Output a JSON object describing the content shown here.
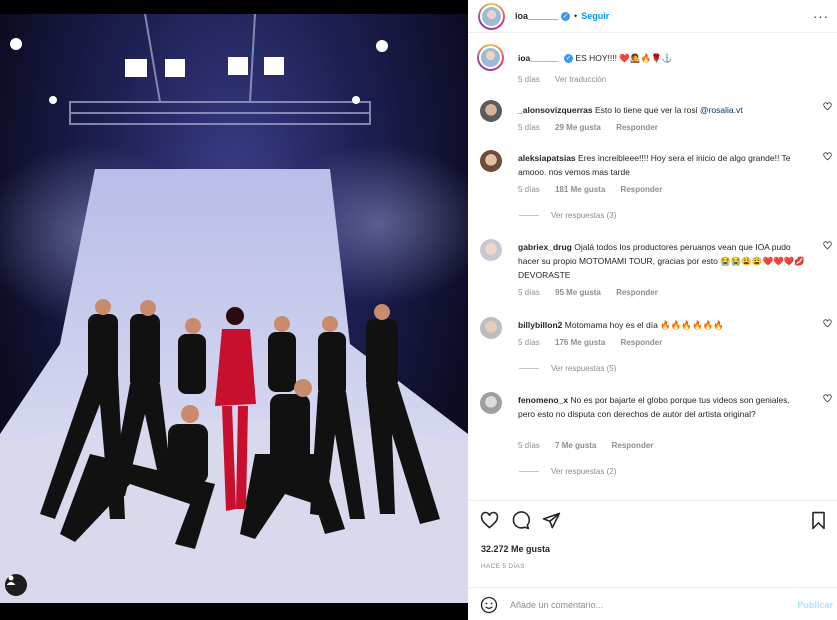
{
  "header": {
    "username": "ioa______",
    "separator": "•",
    "follow_label": "Seguir",
    "more_label": "···"
  },
  "caption": {
    "username": "ioa______",
    "text": "ES HOY!!!! ❤️🧑‍🎤🔥🌹⚓",
    "time": "5 días",
    "translate_label": "Ver traducción"
  },
  "comments": [
    {
      "username": "_alonsovizquerras",
      "text": "Esto lo tiene que ver la rosi",
      "mention": "@rosalia.vt",
      "time": "5 días",
      "likes": "29 Me gusta",
      "reply_label": "Responder"
    },
    {
      "username": "aleksiapatsias",
      "text": "Eres increibleee!!!! Hoy sera el inicio de algo grande!! Te amooo. nos vemos mas tarde",
      "time": "5 días",
      "likes": "181 Me gusta",
      "reply_label": "Responder",
      "view_replies": "Ver respuestas (3)"
    },
    {
      "username": "gabriex_drug",
      "text": "Ojalá todos los productores peruanos vean que IOA pudo hacer su propio MOTOMAMI TOUR, gracias por esto 😭😭😩😩❤️❤️❤️💋 DEVORASTE",
      "time": "5 días",
      "likes": "95 Me gusta",
      "reply_label": "Responder"
    },
    {
      "username": "billybillon2",
      "text": "Motomama hoy es el día 🔥🔥🔥🔥🔥🔥",
      "time": "5 días",
      "likes": "176 Me gusta",
      "reply_label": "Responder",
      "view_replies": "Ver respuestas (5)"
    },
    {
      "username": "fenomeno_x",
      "text": "No es por bajarte el globo porque tus videos son geniales, pero esto no disputa con derechos de autor del artista original?",
      "time": "5 días",
      "likes": "7 Me gusta",
      "reply_label": "Responder",
      "view_replies": "Ver respuestas (2)"
    }
  ],
  "actions": {
    "likes": "32.272 Me gusta",
    "posted_ago": "HACE 5 DÍAS",
    "comment_placeholder": "Añade un comentario...",
    "publish_label": "Publicar"
  },
  "colors": {
    "accent": "#0095f6",
    "muted": "#8e8e8e",
    "text": "#262626"
  }
}
